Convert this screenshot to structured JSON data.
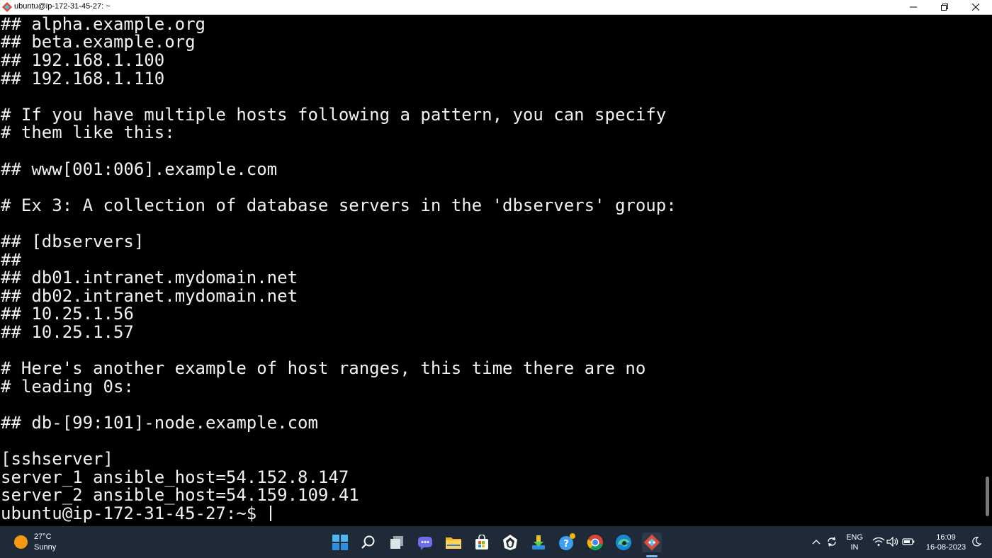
{
  "window": {
    "title": "ubuntu@ip-172-31-45-27: ~"
  },
  "terminal": {
    "lines": [
      "## alpha.example.org",
      "## beta.example.org",
      "## 192.168.1.100",
      "## 192.168.1.110",
      "",
      "# If you have multiple hosts following a pattern, you can specify",
      "# them like this:",
      "",
      "## www[001:006].example.com",
      "",
      "# Ex 3: A collection of database servers in the 'dbservers' group:",
      "",
      "## [dbservers]",
      "##",
      "## db01.intranet.mydomain.net",
      "## db02.intranet.mydomain.net",
      "## 10.25.1.56",
      "## 10.25.1.57",
      "",
      "# Here's another example of host ranges, this time there are no",
      "# leading 0s:",
      "",
      "## db-[99:101]-node.example.com",
      "",
      "[sshserver]",
      "server_1 ansible_host=54.152.8.147",
      "server_2 ansible_host=54.159.109.41"
    ],
    "prompt": "ubuntu@ip-172-31-45-27:~$ "
  },
  "taskbar": {
    "weather": {
      "temp": "27°C",
      "condition": "Sunny"
    },
    "apps": [
      "windows-start",
      "search",
      "task-view",
      "teams-chat",
      "file-explorer",
      "microsoft-store",
      "wolf-app",
      "download-app",
      "help-app",
      "chrome",
      "edge",
      "git-bash"
    ],
    "tray": {
      "lang_top": "ENG",
      "lang_bottom": "IN",
      "time": "16:09",
      "date": "16-08-2023"
    }
  },
  "colors": {
    "terminal_bg": "#000000",
    "terminal_fg": "#f2f2f2",
    "taskbar_bg": "#1f2a38",
    "accent": "#7fb7ee"
  }
}
